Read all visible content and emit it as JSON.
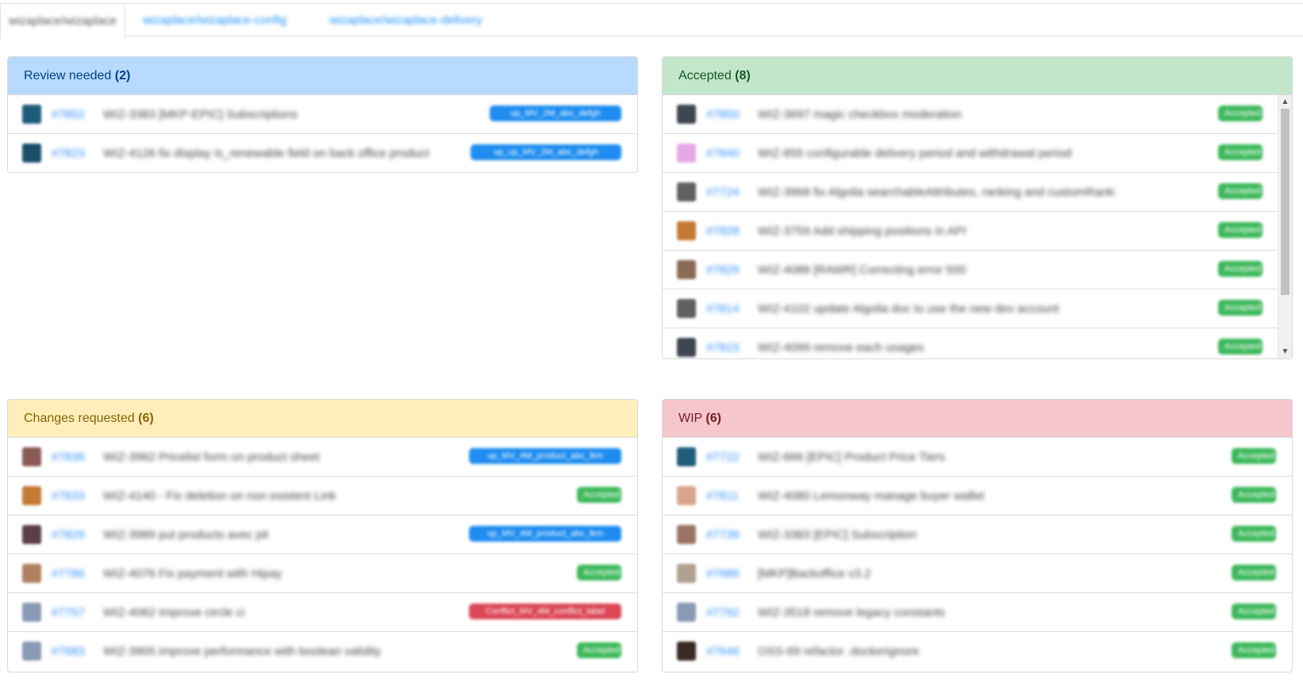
{
  "tabs": [
    {
      "label": "wizaplace/wizaplace",
      "active": true
    },
    {
      "label": "wizaplace/wizaplace-config",
      "active": false
    },
    {
      "label": "wizaplace/wizaplace-delivery",
      "active": false
    }
  ],
  "panels": {
    "review": {
      "title": "Review needed",
      "count": "(2)",
      "rows": [
        {
          "avatar_color": "#1f5c7a",
          "number": "#7852",
          "title": "WIZ-3383 [MKP-EPIC] Subscriptions",
          "badge": "up_MV_2M_abc_defgh",
          "badge_color": "blue",
          "badge_width": 166
        },
        {
          "avatar_color": "#1a4f6b",
          "number": "#7823",
          "title": "WIZ-4126 fix display is_renewable field on back office product",
          "badge": "up_up_MV_2M_abc_defgh",
          "badge_color": "blue",
          "badge_width": 190
        }
      ]
    },
    "accepted": {
      "title": "Accepted",
      "count": "(8)",
      "rows": [
        {
          "avatar_color": "#3f4650",
          "number": "#7850",
          "title": "WIZ-3697 magic checkbox moderation",
          "badge": "Accepted",
          "badge_color": "green",
          "badge_width": 56
        },
        {
          "avatar_color": "#e7a8e6",
          "number": "#7840",
          "title": "WIZ-855 configurable delivery period and withdrawal period",
          "badge": "Accepted",
          "badge_color": "green",
          "badge_width": 56
        },
        {
          "avatar_color": "#606060",
          "number": "#7724",
          "title": "WIZ-3968 fix Algolia searchableAttributes, ranking and customRanking",
          "badge": "Accepted",
          "badge_color": "green",
          "badge_width": 56
        },
        {
          "avatar_color": "#c47a35",
          "number": "#7828",
          "title": "WIZ-3759 Add shipping positions in API",
          "badge": "Accepted",
          "badge_color": "green",
          "badge_width": 56
        },
        {
          "avatar_color": "#8a6a55",
          "number": "#7829",
          "title": "WIZ-4088 [RAWR] Correcting error 500",
          "badge": "Accepted",
          "badge_color": "green",
          "badge_width": 56
        },
        {
          "avatar_color": "#606060",
          "number": "#7814",
          "title": "WIZ-4102 update Algolia doc to use the new dev account",
          "badge": "Accepted",
          "badge_color": "green",
          "badge_width": 56
        },
        {
          "avatar_color": "#3f4650",
          "number": "#7815",
          "title": "WIZ-4099 remove each usages",
          "badge": "Accepted",
          "badge_color": "green",
          "badge_width": 56
        }
      ]
    },
    "changes": {
      "title": "Changes requested",
      "count": "(6)",
      "rows": [
        {
          "avatar_color": "#8a5a55",
          "number": "#7836",
          "title": "WIZ-3962 Pricelist form on product sheet",
          "badge": "up_MV_4M_product_abc_lkm",
          "badge_color": "blue",
          "badge_width": 192
        },
        {
          "avatar_color": "#c47a35",
          "number": "#7833",
          "title": "WIZ-4140 - Fix deletion on non existent Link",
          "badge": "Accepted",
          "badge_color": "green",
          "badge_width": 56
        },
        {
          "avatar_color": "#5a4045",
          "number": "#7829",
          "title": "WIZ-3989 put products avec pit",
          "badge": "up_MV_4M_product_abc_lkm",
          "badge_color": "blue",
          "badge_width": 192
        },
        {
          "avatar_color": "#b08060",
          "number": "#7786",
          "title": "WIZ-4076 Fix payment with Hipay",
          "badge": "Accepted",
          "badge_color": "green",
          "badge_width": 56
        },
        {
          "avatar_color": "#8a9ab5",
          "number": "#7757",
          "title": "WIZ-4062 Improve circle ci",
          "badge": "Conflict_MV_4M_conflict_label",
          "badge_color": "red",
          "badge_width": 192
        },
        {
          "avatar_color": "#8a9ab5",
          "number": "#7683",
          "title": "WIZ-3905 improve performance with boolean validity",
          "badge": "Accepted",
          "badge_color": "green",
          "badge_width": 56
        }
      ]
    },
    "wip": {
      "title": "WIP",
      "count": "(6)",
      "rows": [
        {
          "avatar_color": "#1f5c7a",
          "number": "#7722",
          "title": "WIZ-666 [EPIC] Product Price Tiers",
          "badge": "Accepted",
          "badge_color": "green",
          "badge_width": 56
        },
        {
          "avatar_color": "#d8a58a",
          "number": "#7811",
          "title": "WIZ-4080 Lemonway manage buyer wallet",
          "badge": "Accepted",
          "badge_color": "green",
          "badge_width": 56
        },
        {
          "avatar_color": "#9a7565",
          "number": "#7739",
          "title": "WIZ-3383 [EPIC] Subscription",
          "badge": "Accepted",
          "badge_color": "green",
          "badge_width": 56
        },
        {
          "avatar_color": "#b0a090",
          "number": "#7686",
          "title": "[MKP]Backoffice v3.2",
          "badge": "Accepted",
          "badge_color": "green",
          "badge_width": 56
        },
        {
          "avatar_color": "#8a9ab5",
          "number": "#7792",
          "title": "WIZ-3518 remove legacy constants",
          "badge": "Accepted",
          "badge_color": "green",
          "badge_width": 56
        },
        {
          "avatar_color": "#3a2a25",
          "number": "#7646",
          "title": "OSS-69 refactor .dockerignore",
          "badge": "Accepted",
          "badge_color": "green",
          "badge_width": 56
        }
      ]
    }
  },
  "scrollbar": {
    "up_glyph": "▲",
    "down_glyph": "▼"
  }
}
